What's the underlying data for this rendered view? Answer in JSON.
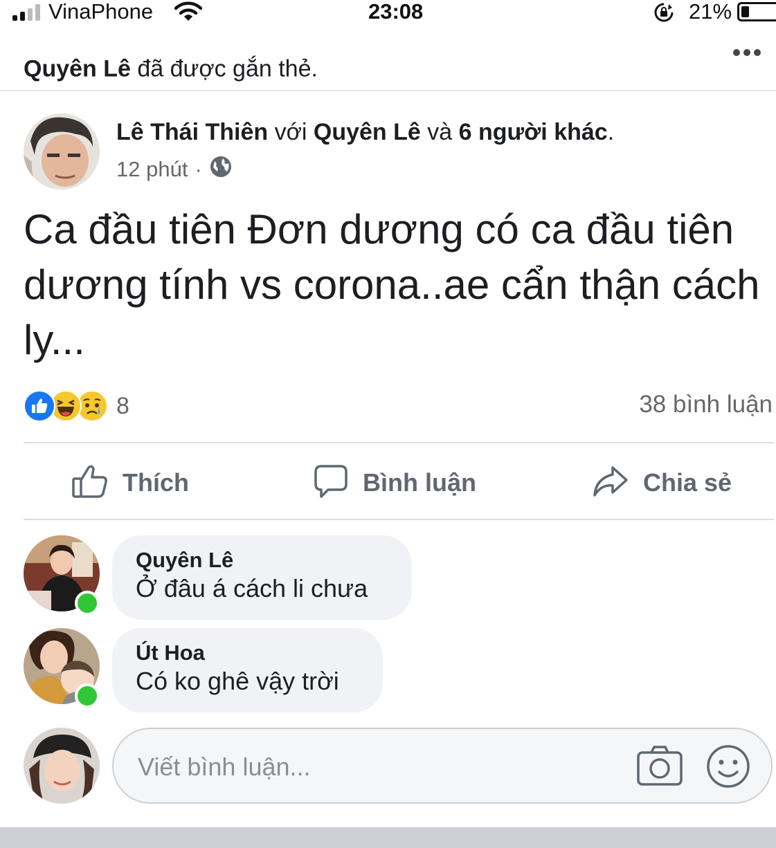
{
  "status_bar": {
    "carrier": "VinaPhone",
    "time": "23:08",
    "battery_percent": "21%",
    "battery_level": 0.21
  },
  "tag_notice": {
    "name": "Quyên Lê",
    "text": " đã được gắn thẻ."
  },
  "post": {
    "author": "Lê Thái Thiên",
    "with_word": " với ",
    "tagged_person": "Quyên Lê",
    "and_word": " và ",
    "others": "6 người khác",
    "period": ".",
    "time": "12 phút",
    "separator": "·",
    "privacy_icon": "globe-icon",
    "body": "Ca đầu tiên Đơn dương có ca đầu tiên dương tính vs corona..ae cẩn thận cách ly..."
  },
  "reactions": {
    "types": [
      "like",
      "haha",
      "sad"
    ],
    "count": "8",
    "comments_label": "38 bình luận"
  },
  "actions": {
    "like": "Thích",
    "comment": "Bình luận",
    "share": "Chia sẻ"
  },
  "comments": [
    {
      "author": "Quyên Lê",
      "text": "Ở đâu á cách li chưa",
      "online": true
    },
    {
      "author": "Út Hoa",
      "text": "Có ko ghê vậy trời",
      "online": true
    }
  ],
  "composer": {
    "placeholder": "Viết bình luận...",
    "camera_icon": "camera-icon",
    "emoji_icon": "emoji-icon"
  },
  "colors": {
    "like_blue": "#1877f2",
    "online_green": "#31c636",
    "secondary_text": "#65676b"
  }
}
